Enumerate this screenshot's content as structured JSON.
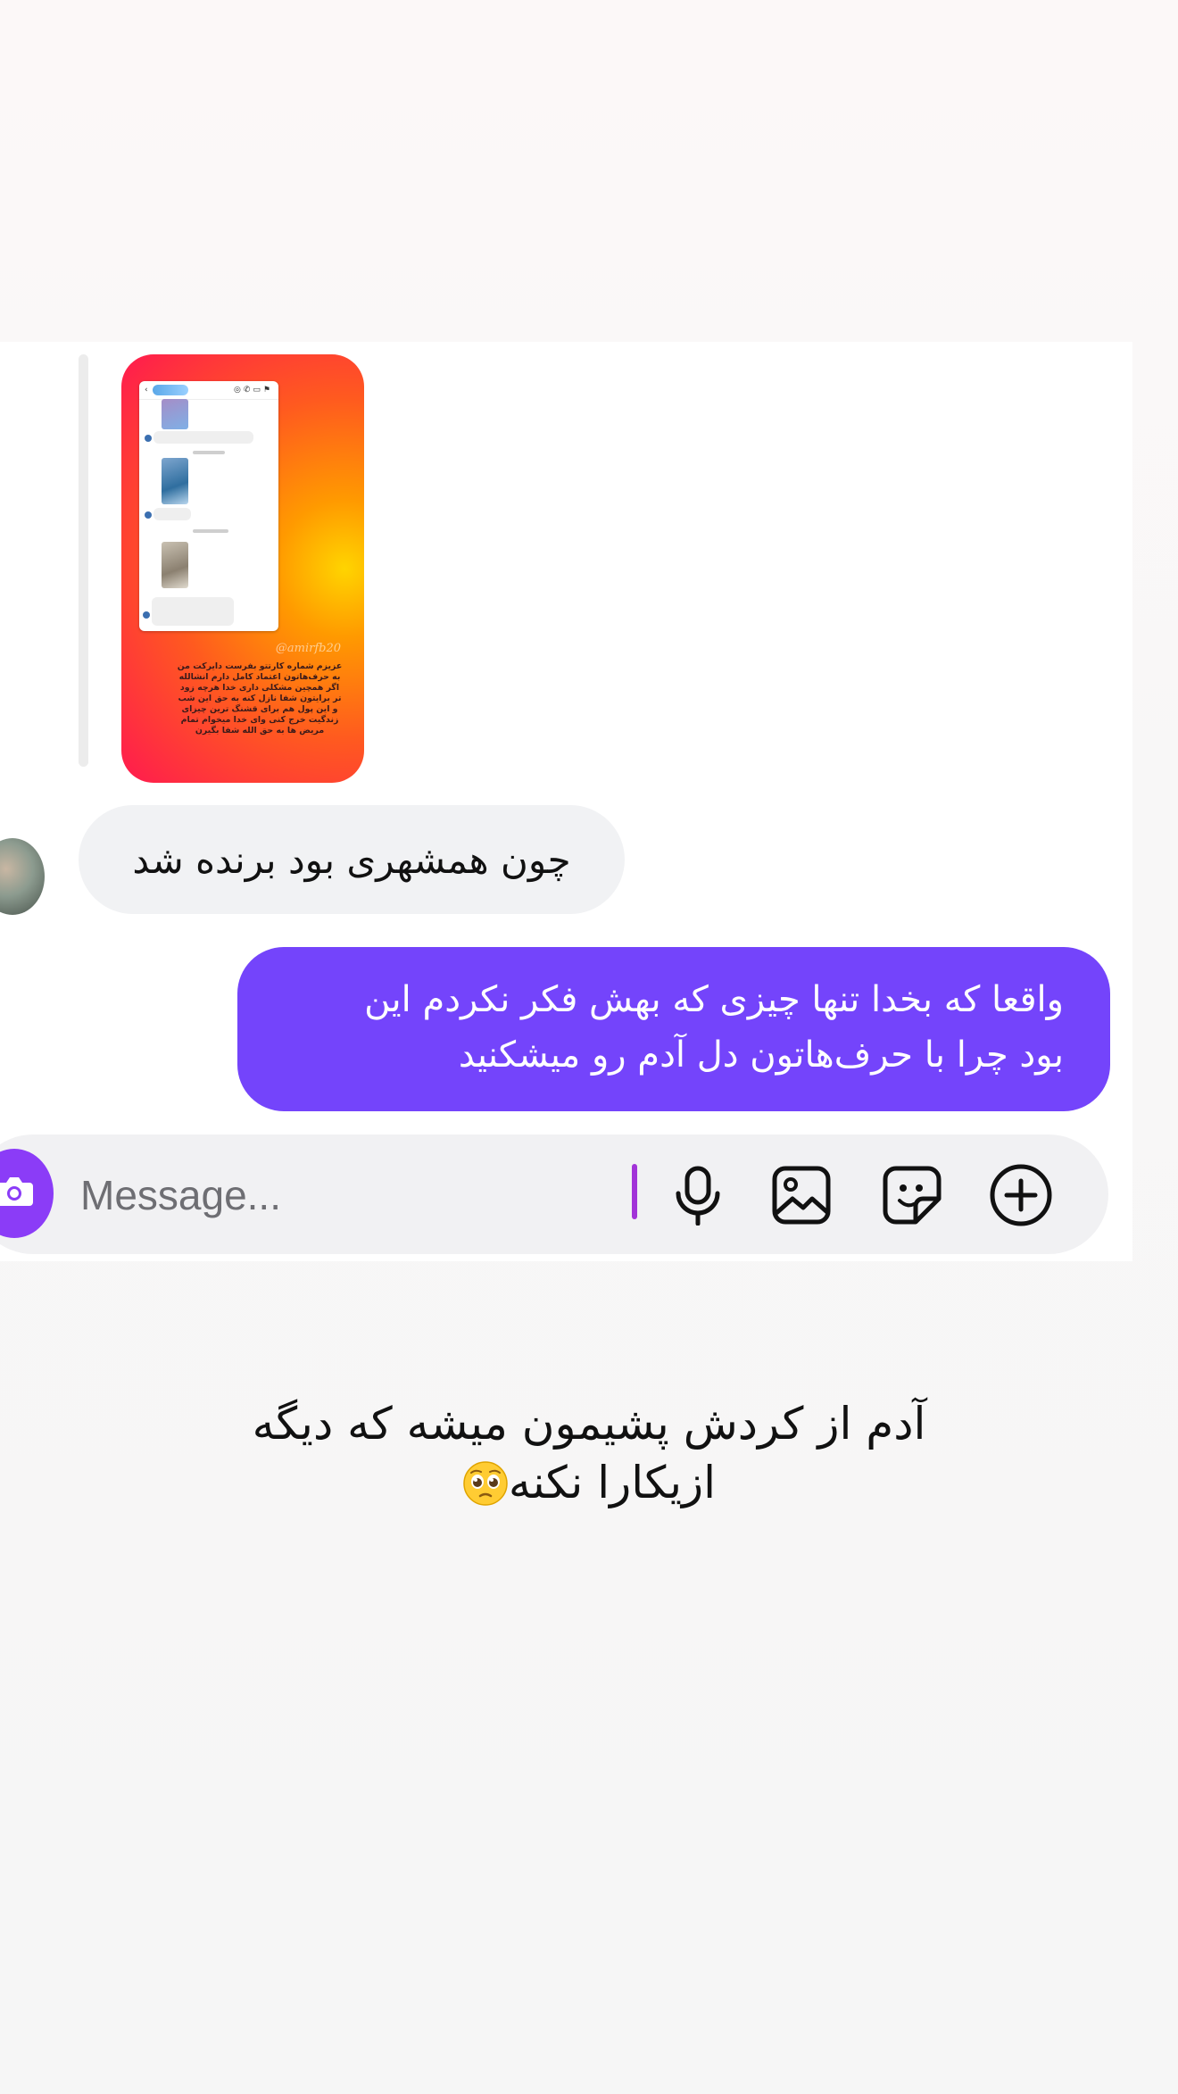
{
  "chat": {
    "shared_post": {
      "username": "@amirfb20",
      "caption": "عزیزم شماره کارتتو بفرست دایرکت من به حرف‌هاتون اعتماد کامل دارم انشالله اگر همچین مشکلی داری خدا هرچه زود تر برایتون شفا نازل کنه به حق این شب و این پول هم برای قشنگ ترین چیزای زندگیت خرج کنی وای خدا میخوام تمام مریض ها به حق الله شفا بگیرن"
    },
    "incoming_message": {
      "text": "چون همشهری بود برنده شد"
    },
    "outgoing_message": {
      "line1": "واقعا که بخدا تنها چیزی که بهش فکر نکردم این",
      "line2": "بود  چرا با حرف‌هاتون دل آدم رو میشکنید"
    },
    "composer": {
      "placeholder": "Message...",
      "icons": [
        "camera-icon",
        "mic-icon",
        "gallery-icon",
        "sticker-icon",
        "plus-icon"
      ],
      "camera_color": "#8b3cf7",
      "caret_color": "#a233d8"
    },
    "outgoing_color": "#7444fb"
  },
  "story_caption": {
    "line1": "آدم از کردش پشیمون میشه که دیگه",
    "line2": "ازیکارا نکنه",
    "emoji": "pleading-face-emoji"
  }
}
